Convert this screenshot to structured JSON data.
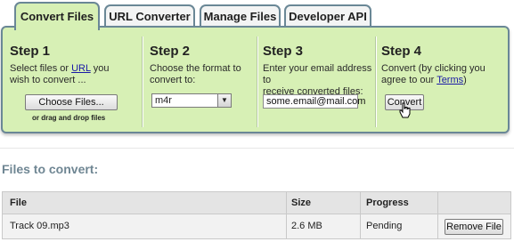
{
  "tabs": [
    "Convert Files",
    "URL Converter",
    "Manage Files",
    "Developer API"
  ],
  "steps": {
    "s1": {
      "title": "Step 1",
      "desc_before": "Select files or ",
      "desc_link": "URL",
      "desc_after_l1": " you",
      "desc_line2": "wish to convert ...",
      "button": "Choose Files...",
      "hint": "or drag and drop files"
    },
    "s2": {
      "title": "Step 2",
      "desc_line1": "Choose the format to",
      "desc_line2": "convert to:",
      "format_value": "m4r"
    },
    "s3": {
      "title": "Step 3",
      "desc_line1": "Enter your email address to",
      "desc_line2": "receive converted files:",
      "email_value": "some.email@mail.com"
    },
    "s4": {
      "title": "Step 4",
      "desc_line1": "Convert (by clicking you",
      "desc_before2": "agree to our ",
      "desc_link": "Terms",
      "desc_after2": ")",
      "button": "Convert"
    }
  },
  "files_section": {
    "title": "Files to convert:",
    "columns": [
      "File",
      "Size",
      "Progress"
    ],
    "rows": [
      {
        "file": "Track 09.mp3",
        "size": "2.6 MB",
        "progress": "Pending",
        "action": "Remove File"
      }
    ]
  },
  "colors": {
    "panel_bg": "#d7f0b5",
    "tab_border": "#6a8796",
    "section_title": "#6f8693",
    "link": "#1a1aa6"
  }
}
